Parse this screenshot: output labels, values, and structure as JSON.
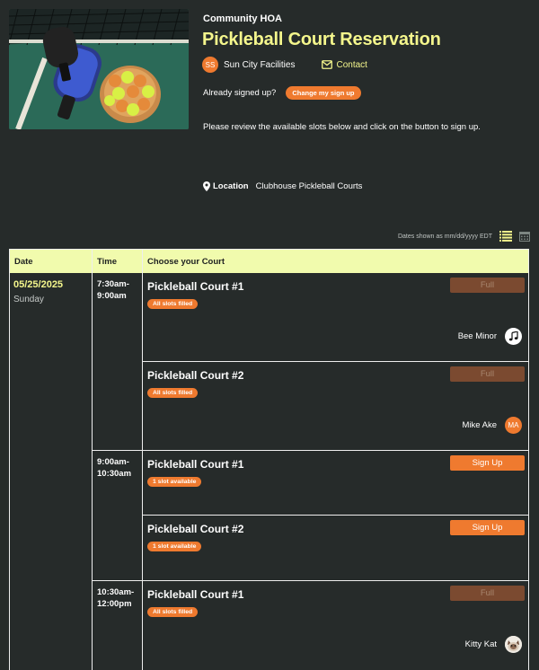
{
  "header": {
    "org_name": "Community HOA",
    "title": "Pickleball Court Reservation",
    "owner": {
      "initials": "SS",
      "name": "Sun City Facilities"
    },
    "contact_label": "Contact",
    "signed_up_prompt": "Already signed up?",
    "change_signup_label": "Change my sign up",
    "instructions": "Please review the available slots below and click on the button to sign up.",
    "location_label": "Location",
    "location_value": "Clubhouse Pickleball Courts"
  },
  "toolbar": {
    "timezone_note": "Dates shown as mm/dd/yyyy EDT",
    "list_view_icon": "list-view-icon",
    "calendar_view_icon": "calendar-view-icon"
  },
  "table": {
    "columns": [
      "Date",
      "Time",
      "Choose your Court"
    ],
    "date": "05/25/2025",
    "day": "Sunday",
    "time_blocks": [
      {
        "time": "7:30am-\n9:00am"
      },
      {
        "time": "9:00am-\n10:30am"
      },
      {
        "time": "10:30am-\n12:00pm"
      }
    ],
    "slots": [
      {
        "court": "Pickleball Court #1",
        "status": "All slots filled",
        "button": "Full",
        "signee": "Bee Minor",
        "avatar": "music-note-icon"
      },
      {
        "court": "Pickleball Court #2",
        "status": "All slots filled",
        "button": "Full",
        "signee": "Mike Ake",
        "avatar_initials": "MA"
      },
      {
        "court": "Pickleball Court #1",
        "status": "1 slot available",
        "button": "Sign Up"
      },
      {
        "court": "Pickleball Court #2",
        "status": "1 slot available",
        "button": "Sign Up"
      },
      {
        "court": "Pickleball Court #1",
        "status": "All slots filled",
        "button": "Full",
        "signee": "Kitty Kat",
        "avatar": "cat-photo-avatar"
      }
    ]
  },
  "colors": {
    "background": "#262b2a",
    "accent_orange": "#ef7a2f",
    "title_yellow": "#f4f68c",
    "header_row": "#f1fbad",
    "full_button": "#7b4a30"
  }
}
